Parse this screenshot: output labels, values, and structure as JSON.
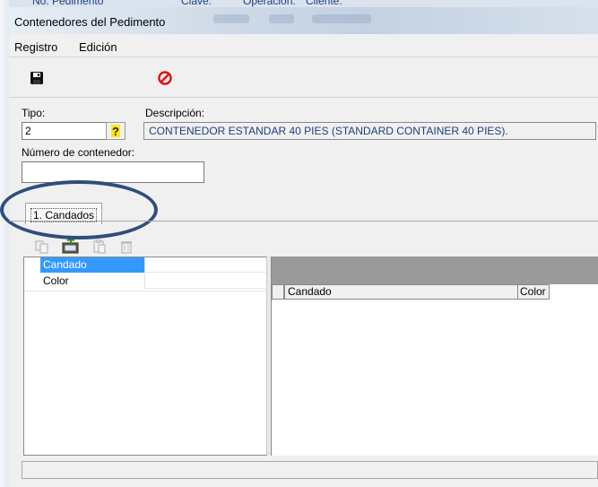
{
  "background_window": {
    "labels": [
      "No. Pedimento",
      "Clave:",
      "Operación:",
      "Cliente:"
    ]
  },
  "window": {
    "title": "Contenedores del Pedimento"
  },
  "menu": {
    "items": [
      "Registro",
      "Edición"
    ]
  },
  "toolbar": {
    "icons": [
      "save-icon",
      "cancel-icon"
    ],
    "grid_icons": [
      "copy-icon",
      "add-record-icon",
      "paste-icon",
      "delete-icon"
    ]
  },
  "form": {
    "tipo_label": "Tipo:",
    "tipo_value": "2",
    "help_glyph": "?",
    "descripcion_label": "Descripción:",
    "descripcion_value": "CONTENEDOR ESTANDAR 40 PIES (STANDARD CONTAINER 40 PIES).",
    "numero_label": "Número de contenedor:",
    "numero_value": ""
  },
  "tabs": [
    {
      "label": "1. Candados"
    }
  ],
  "left_grid": {
    "rows": [
      {
        "name": "Candado",
        "value": "",
        "selected": true
      },
      {
        "name": "Color",
        "value": "",
        "selected": false
      }
    ]
  },
  "right_grid": {
    "columns": [
      "Candado",
      "Color"
    ]
  },
  "colors": {
    "selection": "#3399ff",
    "annotation_ellipse": "#2e4d7d",
    "description_text": "#1c3f7c",
    "cancel_red": "#e01010"
  }
}
